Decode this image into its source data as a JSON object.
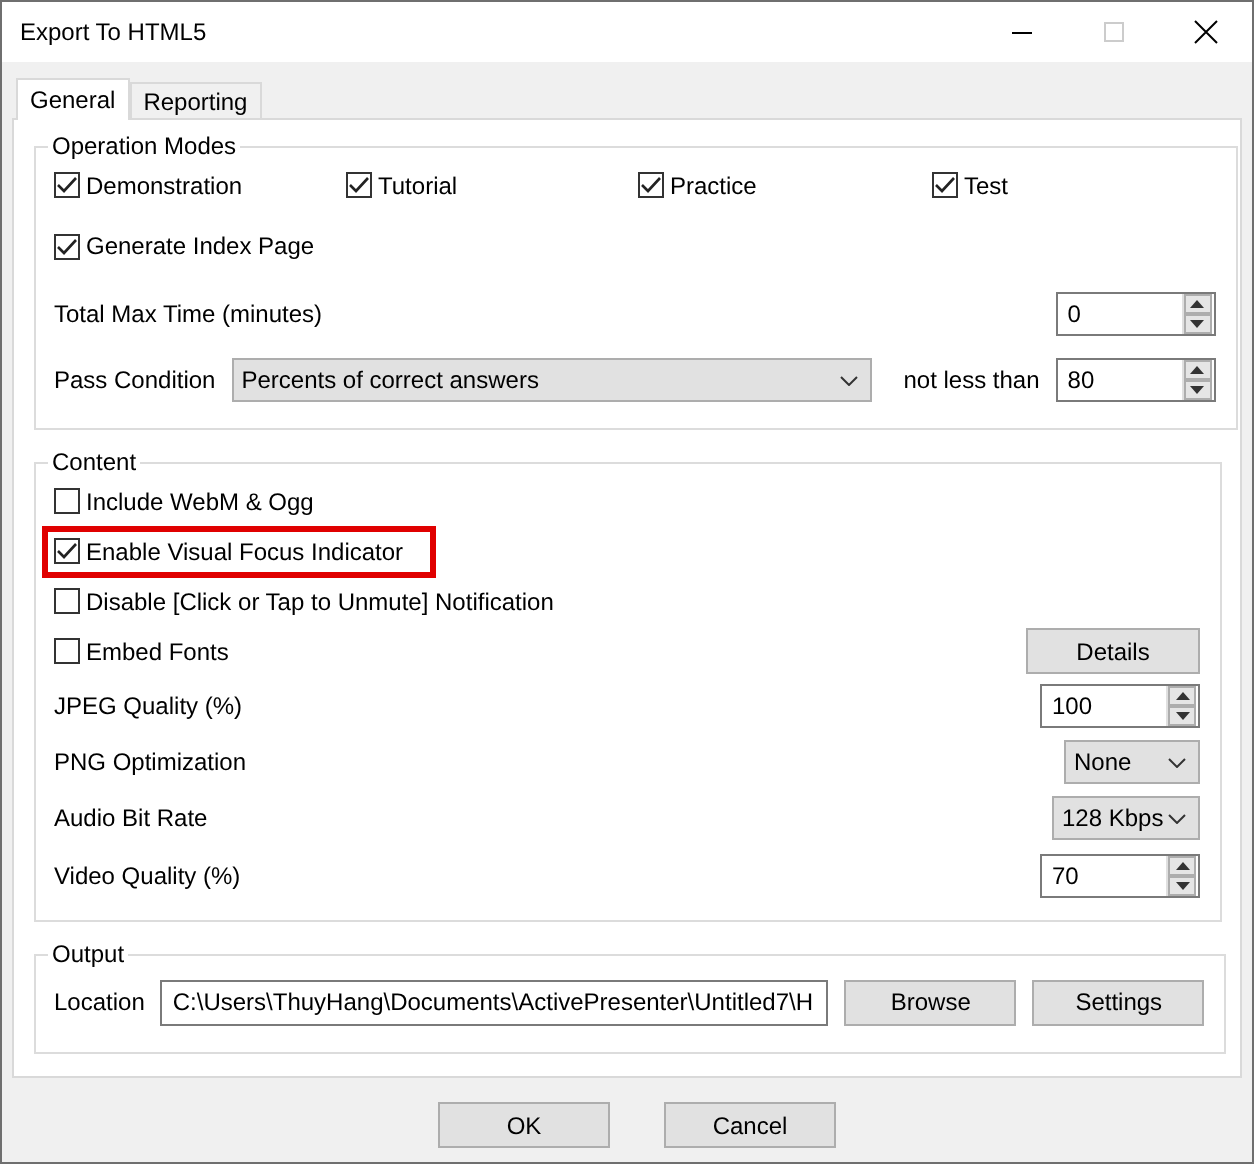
{
  "window": {
    "title": "Export To HTML5",
    "maximize_disabled": true
  },
  "tabs": [
    {
      "label": "General",
      "selected": true
    },
    {
      "label": "Reporting",
      "selected": false
    }
  ],
  "operation_modes": {
    "title": "Operation Modes",
    "modes": [
      {
        "label": "Demonstration",
        "checked": true
      },
      {
        "label": "Tutorial",
        "checked": true
      },
      {
        "label": "Practice",
        "checked": true
      },
      {
        "label": "Test",
        "checked": true
      }
    ],
    "generate_index": {
      "label": "Generate Index Page",
      "checked": true
    },
    "total_max_time": {
      "label": "Total Max Time (minutes)",
      "value": "0"
    },
    "pass_condition": {
      "label": "Pass Condition",
      "value": "Percents of correct answers",
      "compare_label": "not less than",
      "threshold": "80"
    }
  },
  "content": {
    "title": "Content",
    "rows": [
      {
        "kind": "checkbox",
        "label": "Include WebM & Ogg",
        "checked": false,
        "highlighted": false
      },
      {
        "kind": "checkbox",
        "label": "Enable Visual Focus Indicator",
        "checked": true,
        "highlighted": true
      },
      {
        "kind": "checkbox",
        "label": "Disable [Click or Tap to Unmute] Notification",
        "checked": false,
        "highlighted": false
      },
      {
        "kind": "checkbox",
        "label": "Embed Fonts",
        "checked": false,
        "highlighted": false,
        "button": "Details"
      },
      {
        "kind": "spin",
        "label": "JPEG Quality (%)",
        "value": "100"
      },
      {
        "kind": "select",
        "label": "PNG Optimization",
        "value": "None"
      },
      {
        "kind": "select",
        "label": "Audio Bit Rate",
        "value": "128 Kbps"
      },
      {
        "kind": "spin",
        "label": "Video Quality (%)",
        "value": "70"
      }
    ]
  },
  "output": {
    "title": "Output",
    "label": "Location",
    "path": "C:\\Users\\ThuyHang\\Documents\\ActivePresenter\\Untitled7\\H",
    "buttons": [
      "Browse",
      "Settings"
    ]
  },
  "buttons": [
    "OK",
    "Cancel"
  ]
}
